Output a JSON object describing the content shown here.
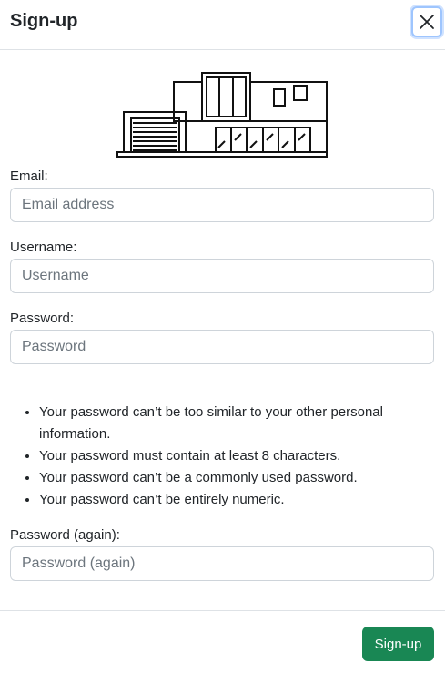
{
  "modal": {
    "title": "Sign-up",
    "close_icon": "close-icon"
  },
  "illustration": {
    "icon": "house-icon"
  },
  "fields": {
    "email": {
      "label": "Email:",
      "placeholder": "Email address",
      "value": ""
    },
    "username": {
      "label": "Username:",
      "placeholder": "Username",
      "value": ""
    },
    "password": {
      "label": "Password:",
      "placeholder": "Password",
      "value": ""
    },
    "password2": {
      "label": "Password (again):",
      "placeholder": "Password (again)",
      "value": ""
    }
  },
  "password_help": [
    "Your password can’t be too similar to your other personal information.",
    "Your password must contain at least 8 characters.",
    "Your password can’t be a commonly used password.",
    "Your password can’t be entirely numeric."
  ],
  "footer": {
    "submit_label": "Sign-up"
  },
  "colors": {
    "primary": "#198754",
    "focus_ring": "#9ec5fe",
    "border": "#ced4da"
  }
}
